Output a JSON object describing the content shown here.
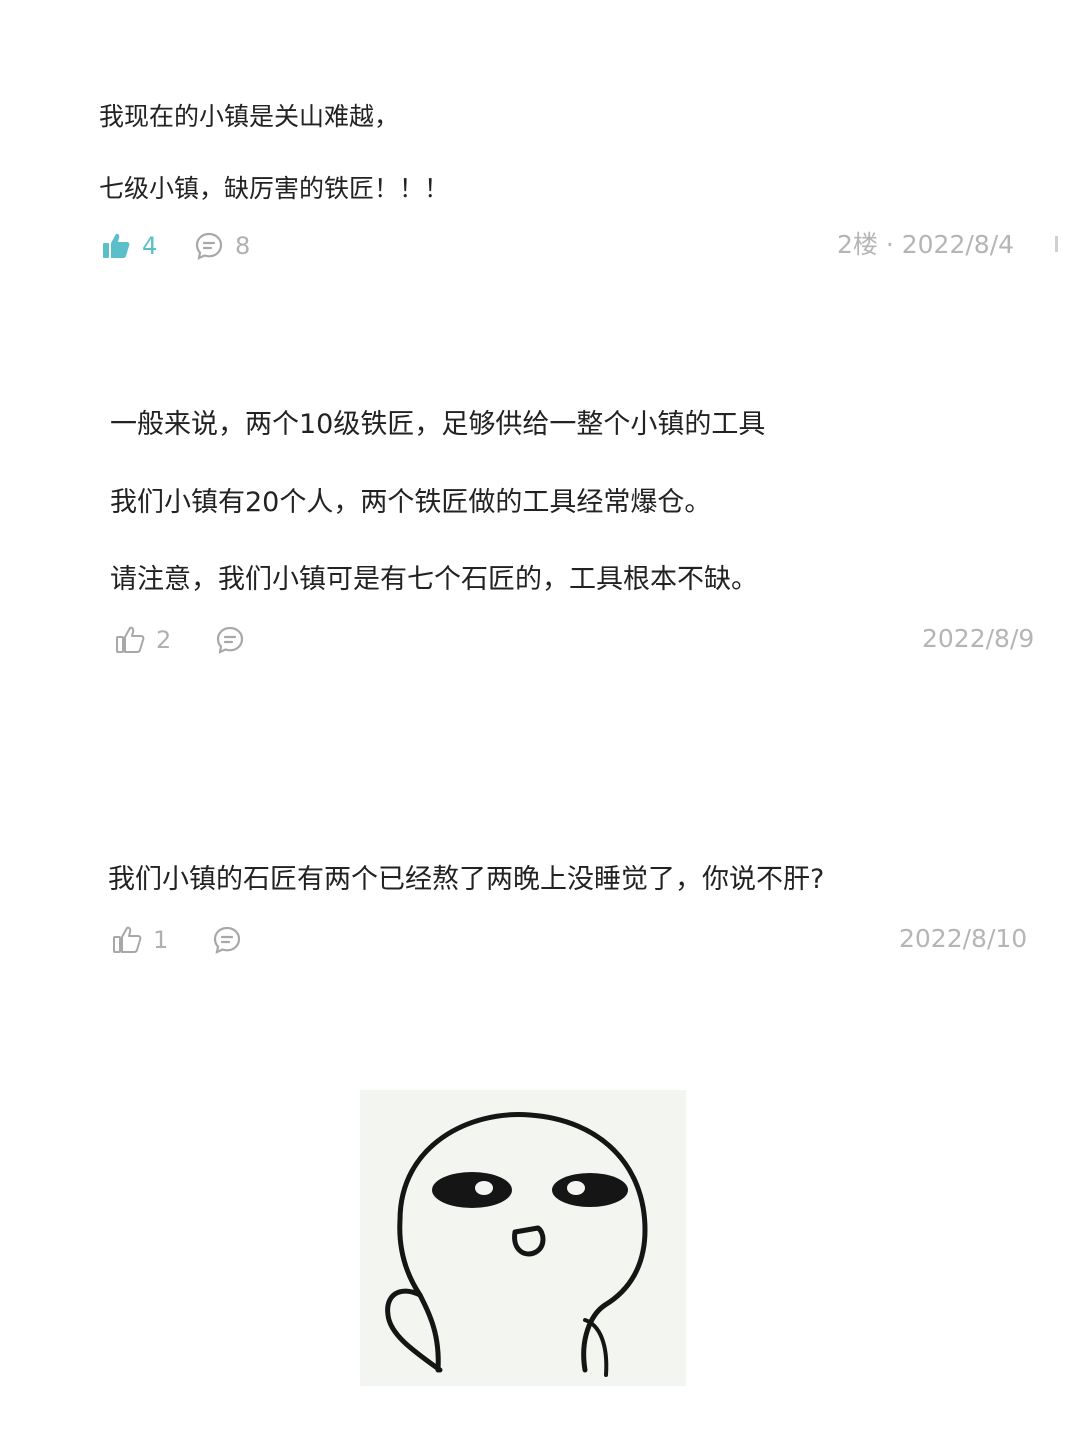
{
  "comments": [
    {
      "lines": [
        "我现在的小镇是关山难越，",
        "七级小镇，缺厉害的铁匠！！！"
      ],
      "likes": "4",
      "replies": "8",
      "floor_date": "2楼 · 2022/8/4",
      "liked": true
    },
    {
      "lines": [
        "一般来说，两个10级铁匠，足够供给一整个小镇的工具",
        "我们小镇有20个人，两个铁匠做的工具经常爆仓。",
        "请注意，我们小镇可是有七个石匠的，工具根本不缺。"
      ],
      "likes": "2",
      "date": "2022/8/9",
      "liked": false
    },
    {
      "lines": [
        "我们小镇的石匠有两个已经熬了两晚上没睡觉了，你说不肝?"
      ],
      "likes": "1",
      "date": "2022/8/10",
      "liked": false
    }
  ],
  "colors": {
    "accent": "#5bbfc9",
    "text": "#222222",
    "muted": "#b5b5b5",
    "icon_gray": "#a8a8a8"
  },
  "icons": {
    "like_filled": "thumbs-up-filled-icon",
    "like_outline": "thumbs-up-outline-icon",
    "reply": "comment-bubble-icon"
  }
}
